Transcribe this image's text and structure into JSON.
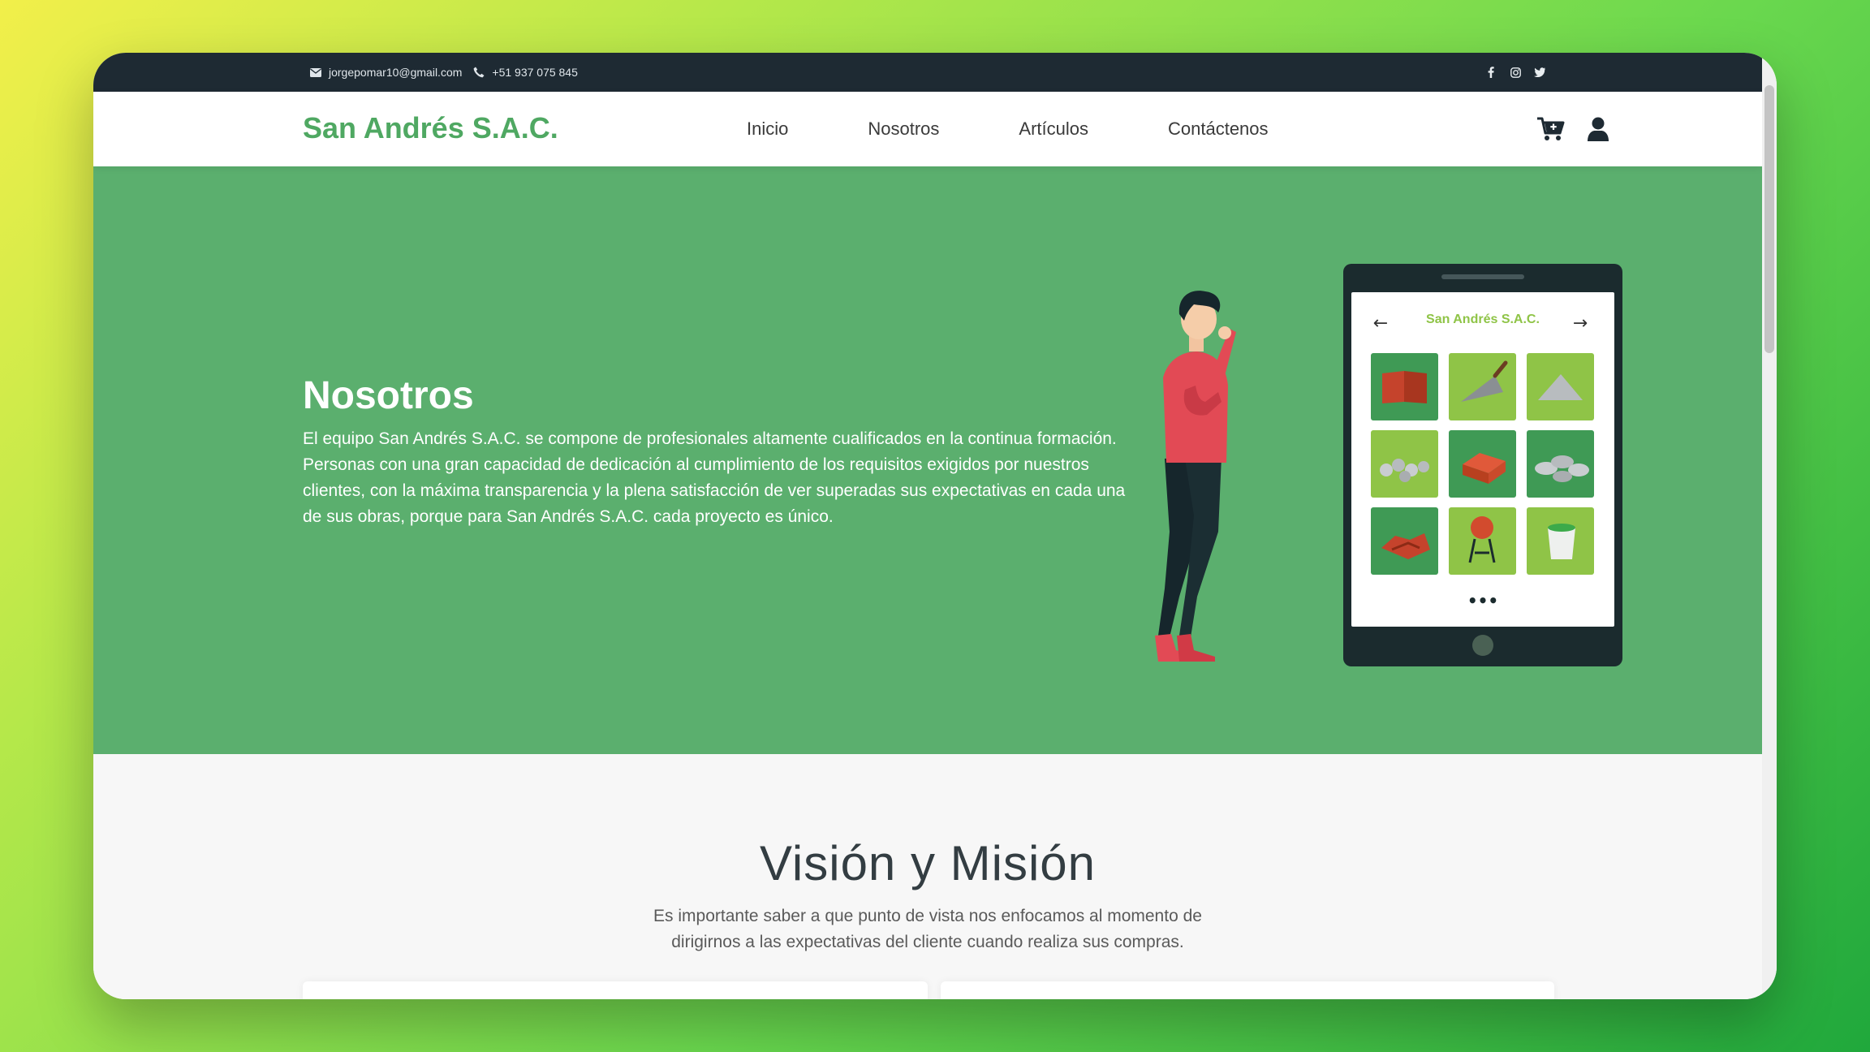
{
  "topbar": {
    "email": "jorgepomar10@gmail.com",
    "phone": "+51 937 075 845",
    "email_icon": "envelope-icon",
    "phone_icon": "phone-icon",
    "social": [
      "facebook-icon",
      "instagram-icon",
      "twitter-icon"
    ]
  },
  "navbar": {
    "brand": "San Andrés S.A.C.",
    "menu": [
      {
        "label": "Inicio"
      },
      {
        "label": "Nosotros"
      },
      {
        "label": "Artículos"
      },
      {
        "label": "Contáctenos"
      }
    ],
    "cart_icon": "cart-icon",
    "user_icon": "user-icon"
  },
  "hero": {
    "title": "Nosotros",
    "text": "El equipo San Andrés S.A.C. se compone de profesionales altamente cualificados en la continua formación. Personas con una gran capacidad de dedicación al cumplimiento de los requisitos exigidos por nuestros clientes, con la máxima transparencia y la plena satisfacción de ver superadas sus expectativas en cada una de sus obras, porque para San Andrés S.A.C. cada proyecto es único.",
    "tablet_title": "San Andrés S.A.C.",
    "tablet_prev": "←",
    "tablet_next": "→",
    "tablet_more": "•••",
    "products": [
      "tile-icon",
      "trowel-icon",
      "cement-pile-icon",
      "gravel-icon",
      "brick-icon",
      "stones-icon",
      "roof-tiles-icon",
      "mixer-icon",
      "paint-bucket-icon"
    ]
  },
  "section2": {
    "title": "Visión y Misión",
    "text": "Es importante saber a que punto de vista nos enfocamos al momento de dirigirnos a las expectativas del cliente cuando realiza sus compras."
  },
  "colors": {
    "topbar": "#1e2a33",
    "brand": "#4fa862",
    "hero": "#5baf6e",
    "tile_light": "#8fc447",
    "tile_dark": "#3f9a55"
  }
}
